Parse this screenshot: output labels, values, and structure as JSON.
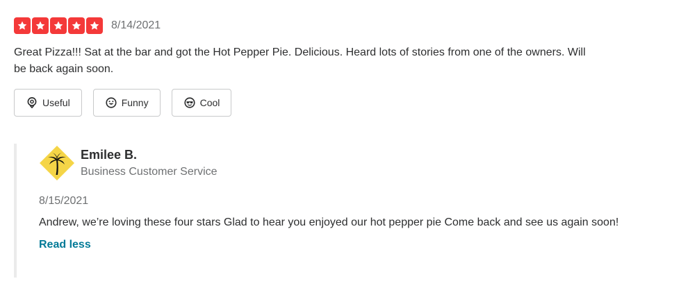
{
  "review": {
    "rating": 5,
    "rating_max": 5,
    "star_color": "#f43939",
    "date": "8/14/2021",
    "text": "Great Pizza!!! Sat at the bar and got the Hot Pepper Pie. Delicious. Heard lots of stories from one of the owners. Will be back again soon.",
    "reactions": [
      {
        "label": "Useful",
        "icon": "lightbulb-icon"
      },
      {
        "label": "Funny",
        "icon": "smile-icon"
      },
      {
        "label": "Cool",
        "icon": "sunglasses-icon"
      }
    ]
  },
  "reply": {
    "owner_name": "Emilee B.",
    "owner_role": "Business Customer Service",
    "logo_icon": "palm-tree-logo-icon",
    "logo_color": "#f5d547",
    "date": "8/15/2021",
    "text": "Andrew, we’re loving these four stars  Glad to hear you enjoyed our hot pepper pie  Come back and see us again soon!",
    "toggle_label": "Read less",
    "link_color": "#027a97"
  }
}
